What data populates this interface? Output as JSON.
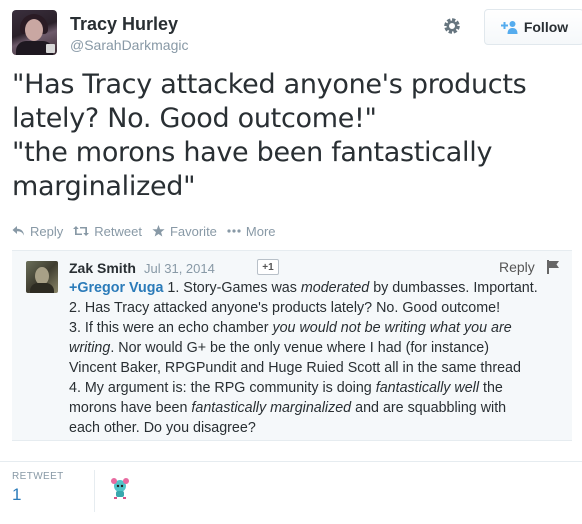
{
  "header": {
    "display_name": "Tracy Hurley",
    "screen_name": "@SarahDarkmagic",
    "follow_label": "Follow"
  },
  "tweet": {
    "lines": [
      "\"Has Tracy attacked anyone's products",
      "lately? No. Good outcome!\"",
      "\"the morons have been fantastically",
      "marginalized\""
    ]
  },
  "actions": {
    "reply": "Reply",
    "retweet": "Retweet",
    "favorite": "Favorite",
    "more": "More"
  },
  "embed": {
    "author": "Zak Smith",
    "date": "Jul 31, 2014",
    "plus_one": "+1",
    "reply": "Reply",
    "mention": "+Gregor Vuga",
    "l1_rest": " 1. Story-Games was ",
    "l1_em": "moderated",
    "l1_end": " by dumbasses. Important.",
    "l2": "2. Has Tracy attacked anyone's products lately? No. Good outcome!",
    "l3_start": "3. If this were an echo chamber ",
    "l3_em": "you would not be writing what you are",
    "l4_em": "writing",
    "l4_end": ". Nor would G+ be the only venue where I had (for instance)",
    "l5": "Vincent Baker, RPGPundit and Huge Ruied Scott all in the same thread",
    "l6_start": "4. My argument is: the RPG community is doing ",
    "l6_em": "fantastically well",
    "l6_end": " the",
    "l7_start": "morons have been ",
    "l7_em": "fantastically marginalized",
    "l7_end": " and are squabbling with",
    "l8": "each other. Do you disagree?"
  },
  "stats": {
    "retweet_label": "RETWEET",
    "retweet_count": "1"
  },
  "icons": {
    "gear": "gear-icon",
    "follow": "follow-person-icon",
    "reply": "reply-icon",
    "retweet": "retweet-icon",
    "favorite": "star-icon",
    "more": "more-dots-icon",
    "flag": "flag-icon"
  },
  "colors": {
    "link": "#2b7bb9",
    "muted": "#8899a6",
    "text": "#292f33",
    "embed_bg": "#f5f8fa"
  }
}
